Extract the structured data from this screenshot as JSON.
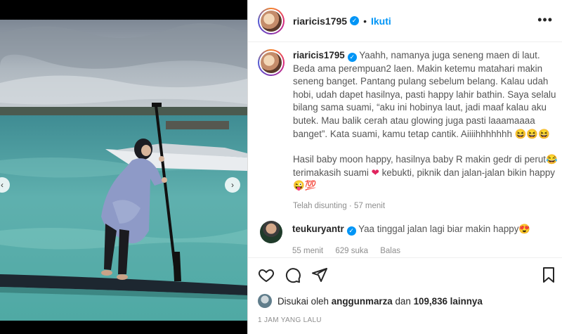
{
  "post": {
    "username": "riaricis1795",
    "follow_label": "Ikuti",
    "more_label": "•••",
    "caption_p1": "Yaahh, namanya juga seneng maen di laut. Beda ama perempuan2 laen. Makin ketemu matahari makin seneng banget. Pantang pulang sebelum belang. Kalau udah hobi, udah dapet hasilnya, pasti happy lahir bathin. Saya selalu bilang sama suami, “aku ini hobinya laut, jadi maaf kalau aku butek. Mau balik cerah atau glowing juga pasti laaamaaaa banget”. Kata suami, kamu tetap cantik. Aiiiihhhhhhh 😆😆😆",
    "caption_p2a": "Hasil baby moon happy, hasilnya baby R makin gedr di perut😂 terimakasih suami",
    "caption_p2b": "kebukti, piknik dan jalan-jalan bikin happy 😜💯",
    "edited_meta": "Telah disunting · 57 menit"
  },
  "comment": {
    "username": "teukuryantr",
    "text": "Yaa tinggal jalan lagi biar makin happy😍",
    "time": "55 menit",
    "likes": "629 suka",
    "reply": "Balas"
  },
  "likes": {
    "prefix": "Disukai oleh",
    "user": "anggunmarza",
    "joiner": "dan",
    "count": "109,836 lainnya"
  },
  "timestamp": "1 JAM YANG LALU",
  "icons": {
    "like": "heart-icon",
    "comment": "comment-icon",
    "share": "share-icon",
    "save": "bookmark-icon",
    "nav_left": "chevron-left-icon",
    "nav_right": "chevron-right-icon"
  },
  "colors": {
    "accent": "#0095f6",
    "heart": "#e0245e",
    "muted": "#8e8e8e"
  }
}
